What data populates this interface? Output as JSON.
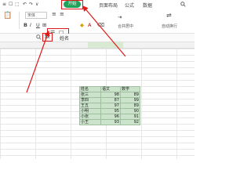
{
  "menu": {
    "items_left": [
      "≡",
      "☐",
      "⬚",
      "↶",
      "↷",
      "∨"
    ],
    "home_tab": "开始",
    "items_right": [
      "页面布局",
      "公式",
      "数据"
    ],
    "search_icon": "search-icon"
  },
  "toolbar": {
    "font_name": "宋体",
    "bold": "B",
    "italic": "I",
    "underline": "U",
    "merge_label": "合并居中",
    "wrap_label": "自动换行"
  },
  "formula": {
    "cell_value": "姓名"
  },
  "table": {
    "rows": [
      [
        "姓名",
        "语文",
        "数学"
      ],
      [
        "张三",
        "98",
        "89"
      ],
      [
        "李四",
        "87",
        "99"
      ],
      [
        "王五",
        "97",
        "89"
      ],
      [
        "小明",
        "95",
        "90"
      ],
      [
        "小张",
        "96",
        "91"
      ],
      [
        "小王",
        "93",
        "92"
      ]
    ]
  },
  "colors": {
    "accent": "#1fa35a",
    "annotation": "#e01a1a",
    "selection": "#cbe3cb"
  }
}
